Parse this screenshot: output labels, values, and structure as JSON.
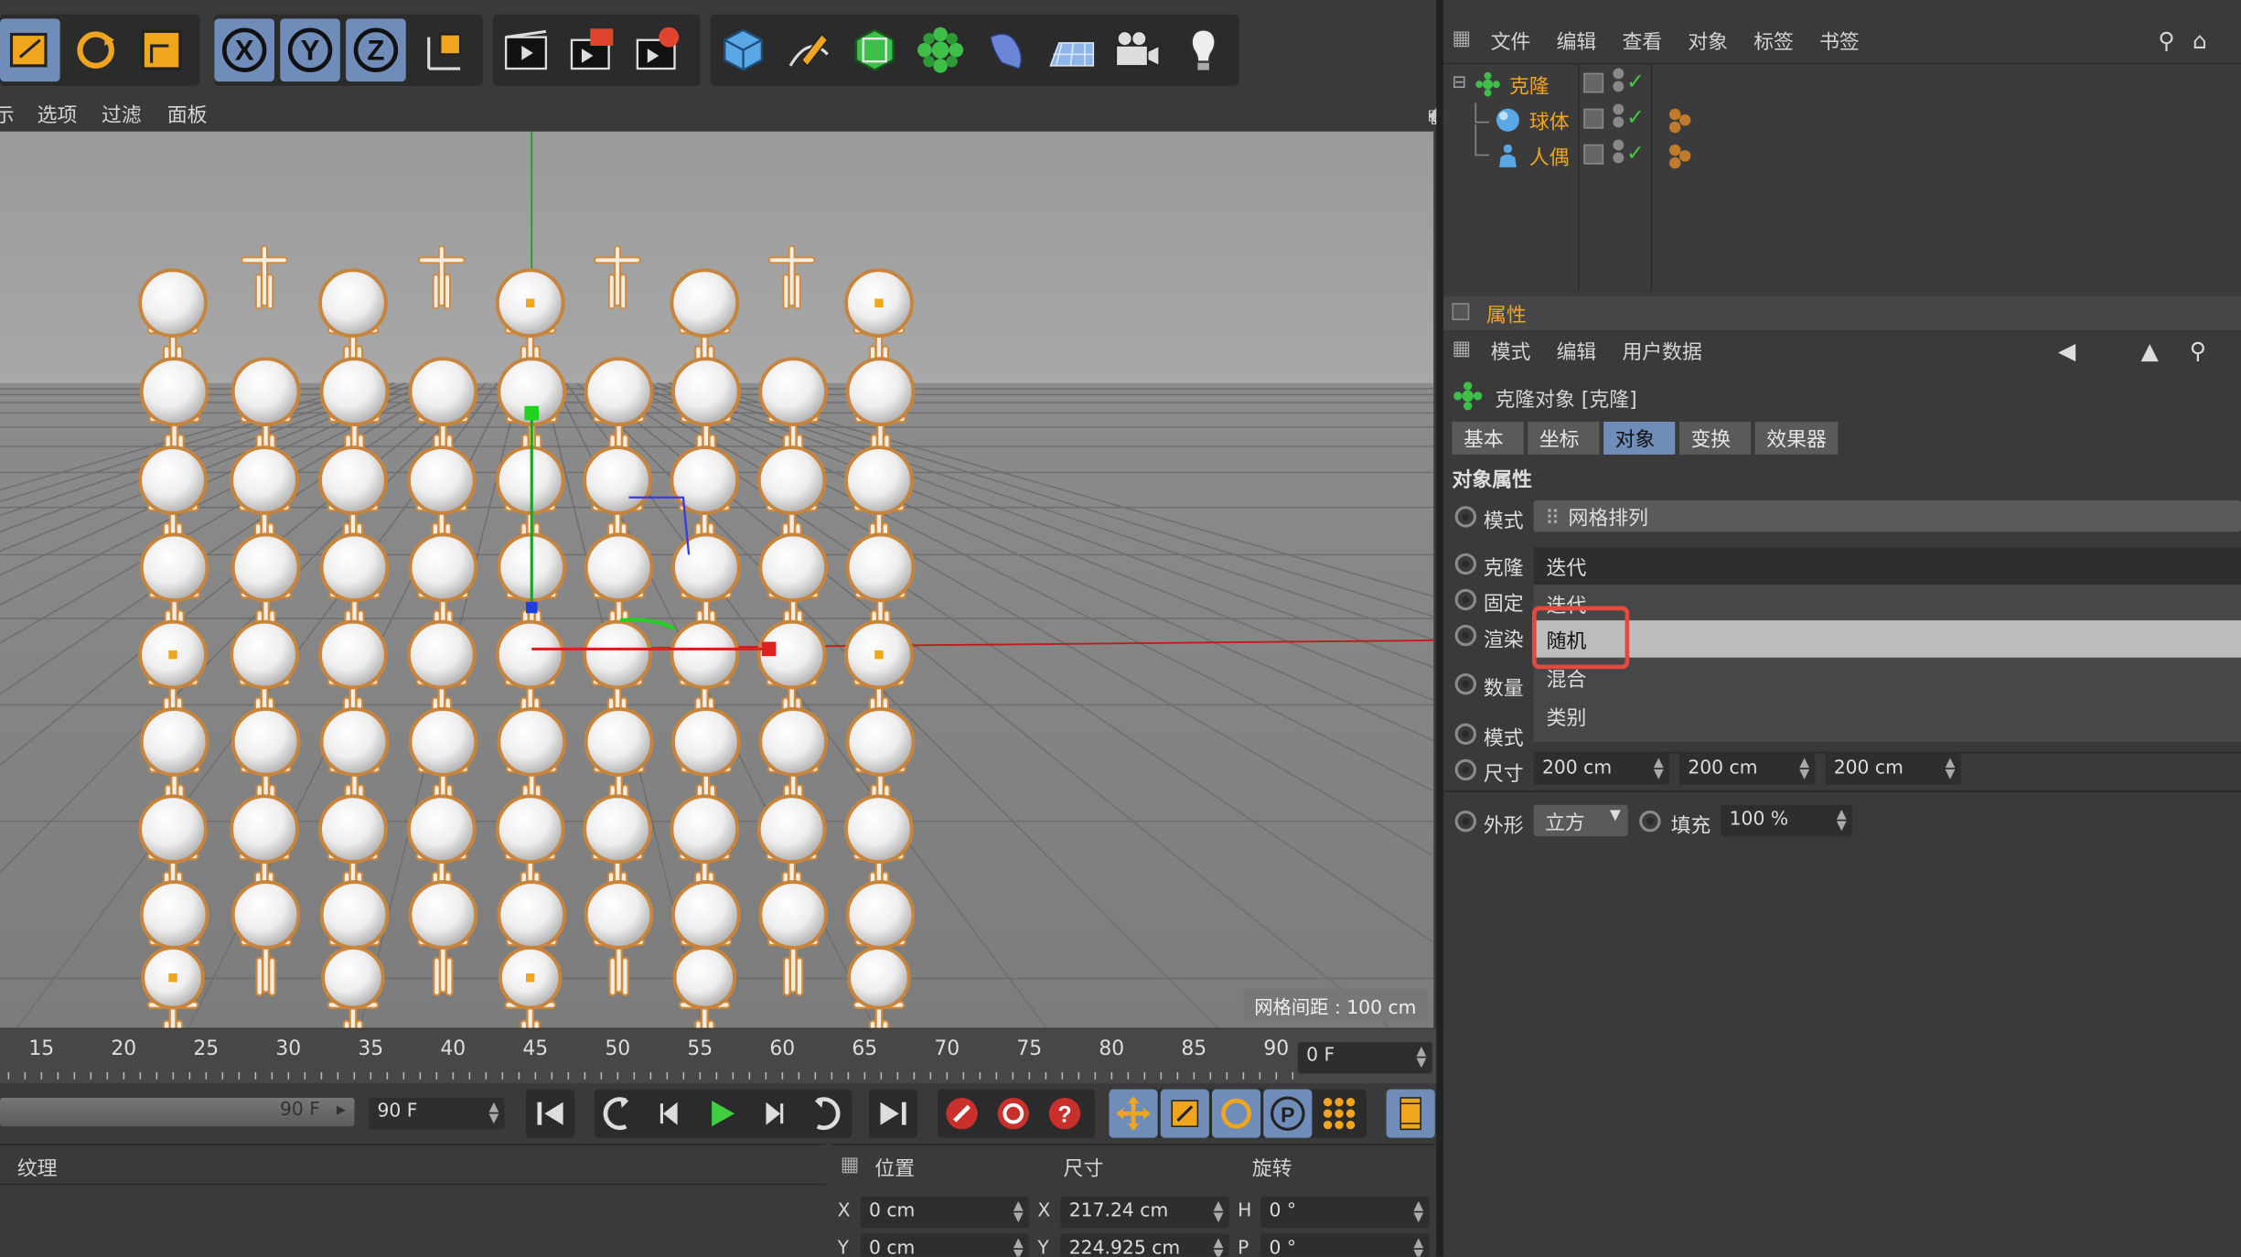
{
  "viewport_menu": [
    "示",
    "选项",
    "过滤",
    "面板"
  ],
  "grid_label": "网格间距 : 100 cm",
  "timeline": {
    "ticks": [
      "15",
      "20",
      "25",
      "30",
      "35",
      "40",
      "45",
      "50",
      "55",
      "60",
      "65",
      "70",
      "75",
      "80",
      "85",
      "90"
    ],
    "current_frame": "0 F"
  },
  "transport": {
    "range_label": "90 F",
    "end_frame": "90 F"
  },
  "material": {
    "header": "纹理"
  },
  "coords": {
    "headers": {
      "position": "位置",
      "size": "尺寸",
      "rotation": "旋转"
    },
    "rows": [
      {
        "axis_pos": "X",
        "pos": "0 cm",
        "axis_size": "X",
        "size": "217.24 cm",
        "axis_rot": "H",
        "rot": "0 °"
      },
      {
        "axis_pos": "Y",
        "pos": "0 cm",
        "axis_size": "Y",
        "size": "224.925 cm",
        "axis_rot": "P",
        "rot": "0 °"
      }
    ]
  },
  "object_manager": {
    "menu": [
      "文件",
      "编辑",
      "查看",
      "对象",
      "标签",
      "书签"
    ],
    "objects": [
      {
        "name": "克隆"
      },
      {
        "name": "球体"
      },
      {
        "name": "人偶"
      }
    ]
  },
  "attributes": {
    "title": "属性",
    "menu": [
      "模式",
      "编辑",
      "用户数据"
    ],
    "object_title": "克隆对象 [克隆]",
    "tabs": [
      "基本",
      "坐标",
      "对象",
      "变换",
      "效果器"
    ],
    "active_tab": "对象",
    "section": "对象属性",
    "mode_label": "模式",
    "mode_value": "网格排列",
    "clone_label": "克隆",
    "clone_value": "迭代",
    "fixed_label": "固定",
    "render_label": "渲染",
    "count_label": "数量",
    "mode2_label": "模式",
    "size_label": "尺寸",
    "size_values": [
      "200 cm",
      "200 cm",
      "200 cm"
    ],
    "shape_label": "外形",
    "shape_value": "立方",
    "fill_label": "填充",
    "fill_value": "100 %"
  },
  "popup": {
    "items": [
      "迭代",
      "随机",
      "混合",
      "类别"
    ],
    "highlighted": "随机"
  },
  "colors": {
    "accent_orange": "#f0a51e",
    "selection_blue": "#6f8db8",
    "highlight_red": "#e8493e"
  }
}
